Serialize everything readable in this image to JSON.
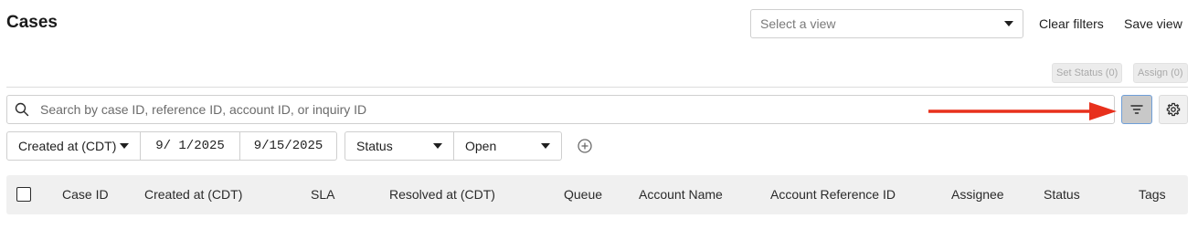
{
  "header": {
    "title": "Cases",
    "view_select_placeholder": "Select a view",
    "clear_filters_label": "Clear filters",
    "save_view_label": "Save view"
  },
  "bulk_actions": {
    "set_status_label": "Set Status (0)",
    "assign_label": "Assign (0)"
  },
  "search": {
    "placeholder": "Search by case ID, reference ID, account ID, or inquiry ID",
    "value": ""
  },
  "filters": {
    "date_field": "Created at (CDT)",
    "date_from": "9/ 1/2025",
    "date_to": "9/15/2025",
    "field": "Status",
    "value": "Open"
  },
  "table": {
    "columns": [
      "Case ID",
      "Created at (CDT)",
      "SLA",
      "Resolved at (CDT)",
      "Queue",
      "Account Name",
      "Account Reference ID",
      "Assignee",
      "Status",
      "Tags"
    ]
  },
  "icons": {
    "search": "search-icon",
    "filter": "filter-icon",
    "settings": "gear-icon",
    "add": "plus-circle-icon",
    "annotation": "red-arrow-icon"
  },
  "colors": {
    "arrow": "#e8301c",
    "filter_button_bg": "#c8c8c8",
    "filter_button_border": "#6f9fd8",
    "table_header_bg": "#f0f0f0"
  }
}
